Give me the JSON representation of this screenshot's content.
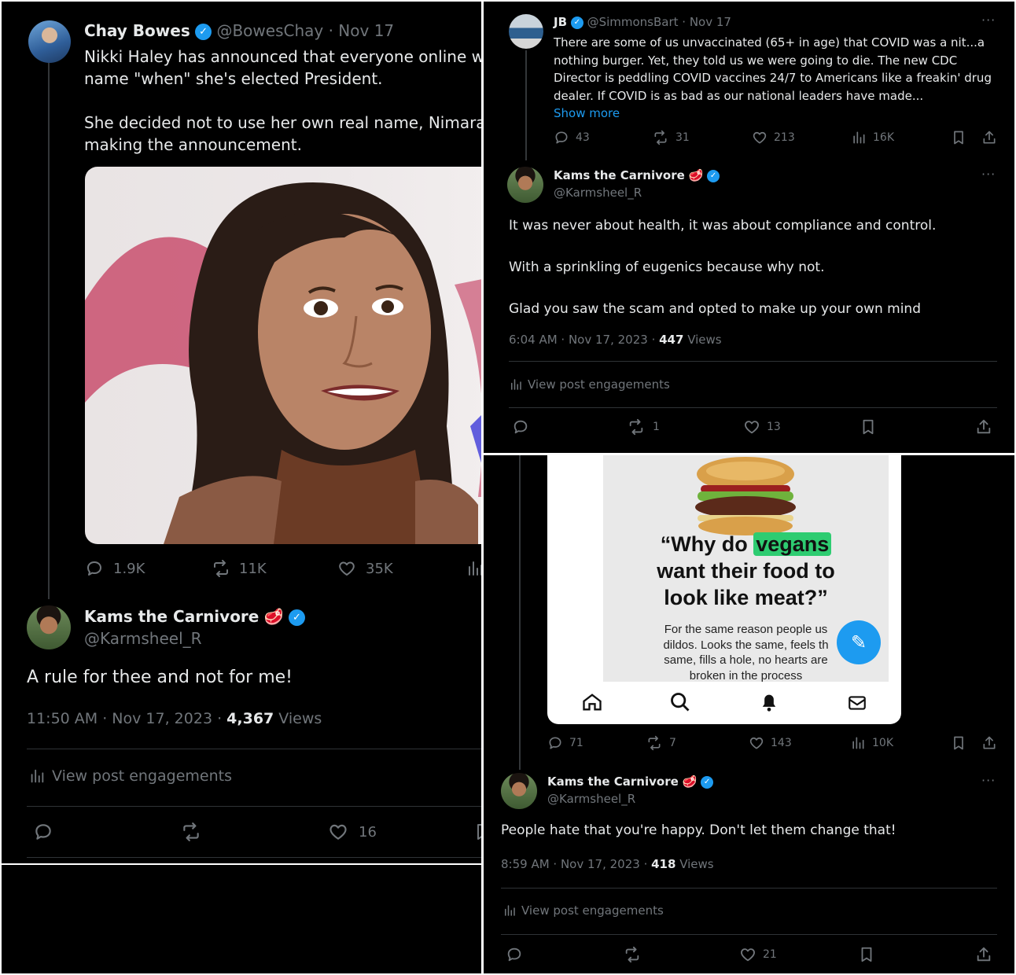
{
  "left": {
    "tweet": {
      "name": "Chay Bowes",
      "handle": "@BowesChay",
      "date": "· Nov 17",
      "line1": "Nikki Haley has announced that everyone online will",
      "line2": "name \"when\" she's elected President.",
      "line3": "She decided not to use her own real name, Nimarata",
      "line4": "making the announcement.",
      "replies": "1.9K",
      "reposts": "11K",
      "likes": "35K"
    },
    "reply": {
      "name": "Kams the Carnivore",
      "handle": "@Karmsheel_R",
      "text": "A rule for thee and not for me!",
      "time": "11:50 AM · Nov 17, 2023 · ",
      "views_count": "4,367",
      "views_label": " Views",
      "engagements": "View post engagements",
      "likes": "16"
    }
  },
  "topright": {
    "tweet": {
      "name": "JB",
      "handle": "@SimmonsBart · Nov 17",
      "line1": "There are some of us unvaccinated (65+ in age) that COVID was a nit...a",
      "line2": "nothing burger.  Yet, they told us we were going to die.   The new CDC",
      "line3": "Director is peddling COVID vaccines 24/7 to Americans like a freakin' drug",
      "line4": "dealer.   If COVID is as bad as our national leaders have made...",
      "show_more": "Show more",
      "replies": "43",
      "reposts": "31",
      "likes": "213",
      "views": "16K"
    },
    "reply": {
      "name": "Kams the Carnivore",
      "handle": "@Karmsheel_R",
      "p1": "It was never about health, it was about compliance and control.",
      "p2": "With a sprinkling of eugenics because why not.",
      "p3": "Glad you saw the scam and opted to make up your own mind",
      "time": "6:04 AM · Nov 17, 2023 · ",
      "views_count": "447",
      "views_label": " Views",
      "engagements": "View post engagements",
      "reposts": "1",
      "likes": "13"
    }
  },
  "bottomright": {
    "meme": {
      "q1": "“Why do ",
      "q_highlight": "vegans",
      "q2": "want their food to",
      "q3": "look like meat?”",
      "s1": "For the same reason people us",
      "s2": "dildos. Looks the same, feels th",
      "s3": "same, fills a hole, no hearts are",
      "s4": "broken in the process"
    },
    "tweet": {
      "replies": "71",
      "reposts": "7",
      "likes": "143",
      "views": "10K"
    },
    "reply": {
      "name": "Kams the Carnivore",
      "handle": "@Karmsheel_R",
      "text": "People hate that you're happy. Don't let them change that!",
      "time": "8:59 AM · Nov 17, 2023 · ",
      "views_count": "418",
      "views_label": " Views",
      "engagements": "View post engagements",
      "likes": "21"
    }
  },
  "icons": {
    "verified": "verified-badge-icon",
    "steak": "steak-emoji-icon",
    "reply": "reply-icon",
    "repost": "repost-icon",
    "like": "heart-icon",
    "views": "views-bar-icon",
    "bookmark": "bookmark-icon",
    "share": "share-icon",
    "more": "more-icon",
    "home": "home-icon",
    "search": "search-icon",
    "bell": "bell-icon",
    "mail": "mail-icon",
    "compose": "compose-icon"
  },
  "colors": {
    "background": "#000000",
    "accent": "#1d9bf0",
    "muted": "#71767b",
    "text": "#e7e9ea",
    "highlight": "#2ecc71"
  }
}
